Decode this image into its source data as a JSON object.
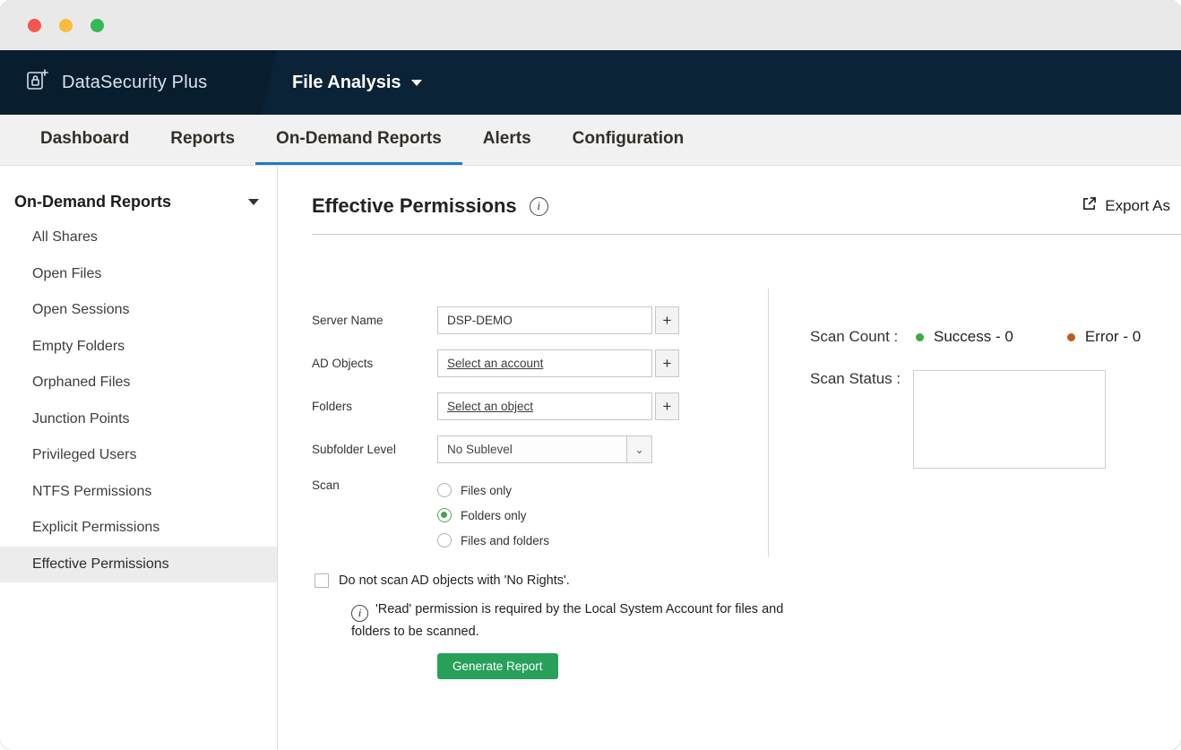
{
  "header": {
    "brand": "DataSecurity Plus",
    "module": "File Analysis"
  },
  "tabs": [
    "Dashboard",
    "Reports",
    "On-Demand Reports",
    "Alerts",
    "Configuration"
  ],
  "active_tab": "On-Demand Reports",
  "sidebar": {
    "title": "On-Demand Reports",
    "items": [
      "All Shares",
      "Open Files",
      "Open Sessions",
      "Empty Folders",
      "Orphaned Files",
      "Junction Points",
      "Privileged Users",
      "NTFS Permissions",
      "Explicit Permissions",
      "Effective Permissions"
    ],
    "selected": "Effective Permissions"
  },
  "main": {
    "title": "Effective Permissions",
    "export_as": "Export As",
    "form": {
      "server_name": {
        "label": "Server Name",
        "value": "DSP-DEMO"
      },
      "ad_objects": {
        "label": "AD Objects",
        "placeholder": "Select an account"
      },
      "folders": {
        "label": "Folders",
        "placeholder": "Select an object"
      },
      "subfolder_level": {
        "label": "Subfolder Level",
        "value": "No Sublevel"
      },
      "scan": {
        "label": "Scan",
        "options": [
          "Files only",
          "Folders only",
          "Files and folders"
        ],
        "selected": "Folders only"
      }
    },
    "checkbox_label": "Do not scan AD objects with 'No Rights'.",
    "note": "'Read' permission is required by the Local System Account for files and folders to be scanned.",
    "generate_button": "Generate Report"
  },
  "status_panel": {
    "scan_count_label": "Scan Count :",
    "success": "Success - 0",
    "error": "Error - 0",
    "scan_status_label": "Scan Status :"
  },
  "colors": {
    "header_navy": "#0a2337",
    "active_tab_blue": "#1b7ad2",
    "button_green": "#28a05a",
    "success_green": "#3fa845",
    "error_orange": "#bf5b1d"
  }
}
